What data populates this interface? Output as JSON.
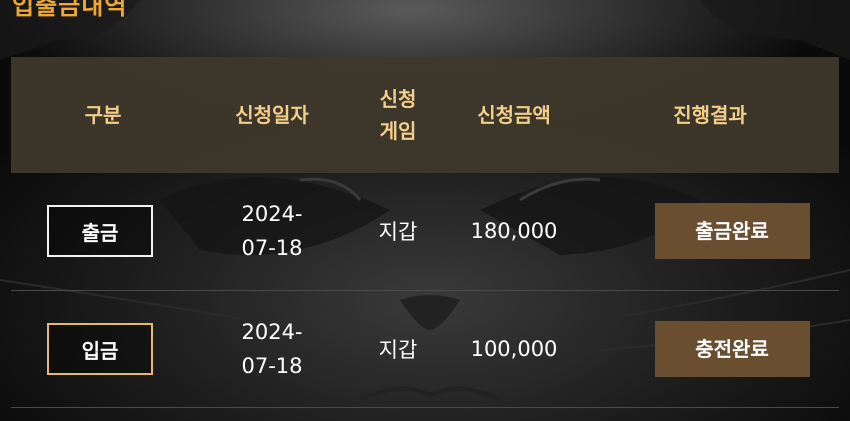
{
  "section": {
    "title": "입출금내역"
  },
  "table": {
    "headers": {
      "type": "구분",
      "date": "신청일자",
      "game_line1": "신청",
      "game_line2": "게임",
      "amount": "신청금액",
      "status": "진행결과"
    },
    "rows": [
      {
        "type": "출금",
        "date_line1": "2024-",
        "date_line2": "07-18",
        "game": "지갑",
        "amount": "180,000",
        "status": "출금완료"
      },
      {
        "type": "입금",
        "date_line1": "2024-",
        "date_line2": "07-18",
        "game": "지갑",
        "amount": "100,000",
        "status": "충전완료"
      }
    ]
  },
  "colors": {
    "title": "#f0a830",
    "header_text": "#f3cf8a",
    "header_bg": "#3e382c",
    "status_button": "#6a4e30",
    "deposit_border": "#e8b86a",
    "withdraw_border": "#f2f2f2",
    "amount_text": "#8f8f8f"
  },
  "icons": {
    "background": "cat-face-illustration"
  }
}
